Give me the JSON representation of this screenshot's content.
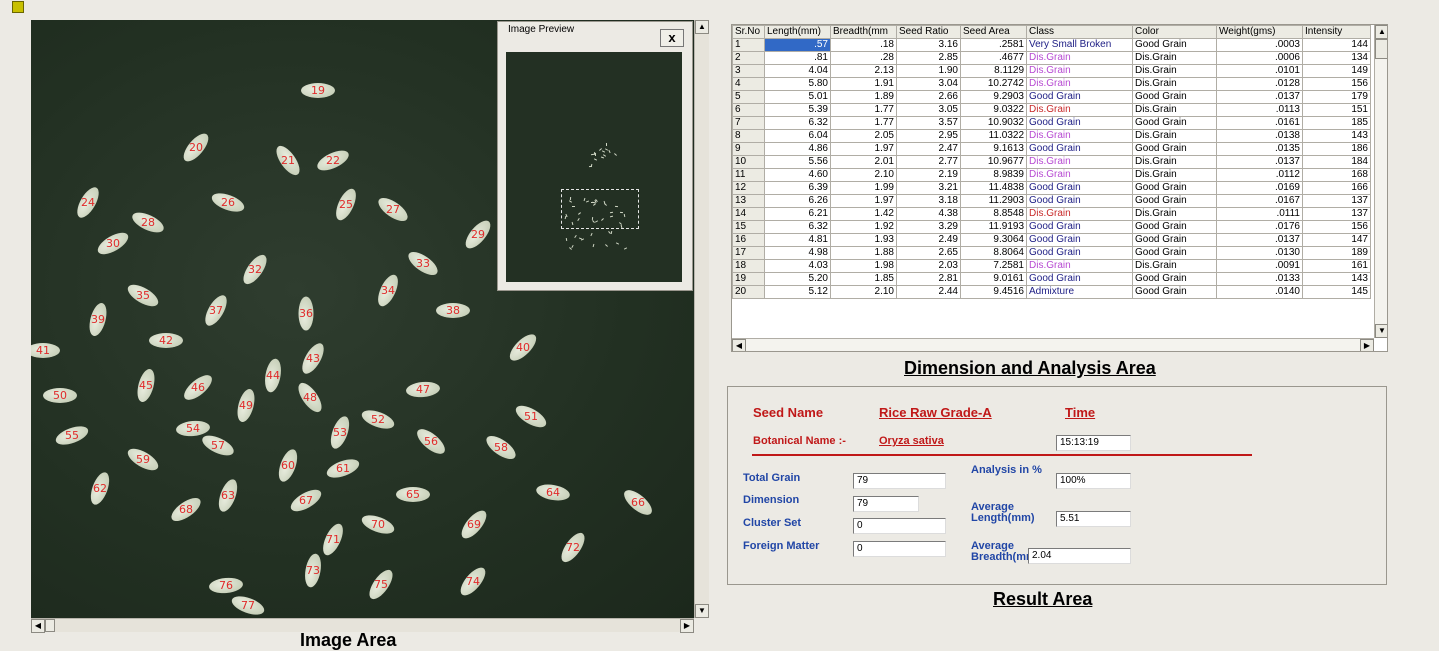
{
  "image_area": {
    "label": "Image Area",
    "seed_labels": [
      "19",
      "20",
      "21",
      "22",
      "24",
      "25",
      "26",
      "27",
      "28",
      "29",
      "30",
      "32",
      "33",
      "34",
      "35",
      "36",
      "37",
      "38",
      "39",
      "40",
      "41",
      "42",
      "43",
      "44",
      "45",
      "46",
      "47",
      "48",
      "49",
      "50",
      "51",
      "52",
      "53",
      "54",
      "55",
      "56",
      "57",
      "58",
      "59",
      "60",
      "61",
      "62",
      "63",
      "64",
      "65",
      "66",
      "67",
      "68",
      "69",
      "70",
      "71",
      "72",
      "73",
      "74",
      "75",
      "76",
      "77"
    ]
  },
  "preview": {
    "title": "Image Preview",
    "close": "x"
  },
  "grid": {
    "columns": [
      "Sr.No",
      "Length(mm)",
      "Breadth(mm",
      "Seed Ratio",
      "Seed Area",
      "Class",
      "Color",
      "Weight(gms)",
      "Intensity"
    ],
    "rows": [
      [
        "1",
        ".57",
        ".18",
        "3.16",
        ".2581",
        "Very Small Broken",
        "Good Grain",
        ".0003",
        "144"
      ],
      [
        "2",
        ".81",
        ".28",
        "2.85",
        ".4677",
        "Dis.Grain",
        "Dis.Grain",
        ".0006",
        "134"
      ],
      [
        "3",
        "4.04",
        "2.13",
        "1.90",
        "8.1129",
        "Dis.Grain",
        "Dis.Grain",
        ".0101",
        "149"
      ],
      [
        "4",
        "5.80",
        "1.91",
        "3.04",
        "10.2742",
        "Dis.Grain",
        "Dis.Grain",
        ".0128",
        "156"
      ],
      [
        "5",
        "5.01",
        "1.89",
        "2.66",
        "9.2903",
        "Good Grain",
        "Good Grain",
        ".0137",
        "179"
      ],
      [
        "6",
        "5.39",
        "1.77",
        "3.05",
        "9.0322",
        "Dis.Grain",
        "Dis.Grain",
        ".0113",
        "151"
      ],
      [
        "7",
        "6.32",
        "1.77",
        "3.57",
        "10.9032",
        "Good Grain",
        "Good Grain",
        ".0161",
        "185"
      ],
      [
        "8",
        "6.04",
        "2.05",
        "2.95",
        "11.0322",
        "Dis.Grain",
        "Dis.Grain",
        ".0138",
        "143"
      ],
      [
        "9",
        "4.86",
        "1.97",
        "2.47",
        "9.1613",
        "Good Grain",
        "Good Grain",
        ".0135",
        "186"
      ],
      [
        "10",
        "5.56",
        "2.01",
        "2.77",
        "10.9677",
        "Dis.Grain",
        "Dis.Grain",
        ".0137",
        "184"
      ],
      [
        "11",
        "4.60",
        "2.10",
        "2.19",
        "8.9839",
        "Dis.Grain",
        "Dis.Grain",
        ".0112",
        "168"
      ],
      [
        "12",
        "6.39",
        "1.99",
        "3.21",
        "11.4838",
        "Good Grain",
        "Good Grain",
        ".0169",
        "166"
      ],
      [
        "13",
        "6.26",
        "1.97",
        "3.18",
        "11.2903",
        "Good Grain",
        "Good Grain",
        ".0167",
        "137"
      ],
      [
        "14",
        "6.21",
        "1.42",
        "4.38",
        "8.8548",
        "Dis.Grain",
        "Dis.Grain",
        ".0111",
        "137"
      ],
      [
        "15",
        "6.32",
        "1.92",
        "3.29",
        "11.9193",
        "Good Grain",
        "Good Grain",
        ".0176",
        "156"
      ],
      [
        "16",
        "4.81",
        "1.93",
        "2.49",
        "9.3064",
        "Good Grain",
        "Good Grain",
        ".0137",
        "147"
      ],
      [
        "17",
        "4.98",
        "1.88",
        "2.65",
        "8.8064",
        "Good Grain",
        "Good Grain",
        ".0130",
        "189"
      ],
      [
        "18",
        "4.03",
        "1.98",
        "2.03",
        "7.2581",
        "Dis.Grain",
        "Dis.Grain",
        ".0091",
        "161"
      ],
      [
        "19",
        "5.20",
        "1.85",
        "2.81",
        "9.0161",
        "Good Grain",
        "Good Grain",
        ".0133",
        "143"
      ],
      [
        "20",
        "5.12",
        "2.10",
        "2.44",
        "9.4516",
        "Admixture",
        "Good Grain",
        ".0140",
        "145"
      ]
    ],
    "class_colors": [
      "vsb",
      "dis",
      "dis",
      "dis",
      "good",
      "dis2",
      "good",
      "dis",
      "good",
      "dis",
      "dis",
      "good",
      "good",
      "dis2",
      "good",
      "good",
      "good",
      "dis",
      "good",
      "good"
    ]
  },
  "dimension_label": "Dimension and Analysis Area",
  "result": {
    "seed_name_label": "Seed Name",
    "seed_name_value": "Rice Raw Grade-A",
    "time_label": "Time",
    "time_value": "15:13:19",
    "botanical_label": "Botanical Name :-",
    "botanical_value": "Oryza sativa",
    "total_grain_label": "Total Grain",
    "total_grain_value": "79",
    "dimension_label": "Dimension",
    "dimension_value": "79",
    "cluster_label": "Cluster Set",
    "cluster_value": "0",
    "foreign_label": "Foreign Matter",
    "foreign_value": "0",
    "analysis_label": "Analysis in %",
    "analysis_value": "100%",
    "avg_length_label": "Average Length(mm)",
    "avg_length_value": "5.51",
    "avg_breadth_label": "Average Breadth(mm)",
    "avg_breadth_value": "2.04"
  },
  "result_area_label": "Result  Area"
}
